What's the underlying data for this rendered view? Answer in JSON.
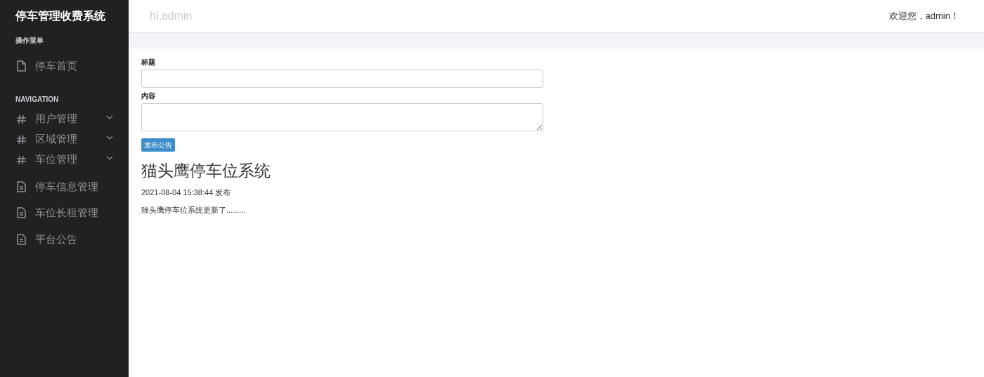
{
  "sidebar": {
    "title": "停车管理收费系统",
    "sections": [
      {
        "heading": "操作菜单",
        "items": [
          {
            "label": "停车首页",
            "kind": "page"
          }
        ]
      },
      {
        "heading": "NAVIGATION",
        "items": [
          {
            "label": "用户管理",
            "kind": "group",
            "expanded": false
          },
          {
            "label": "区域管理",
            "kind": "group",
            "expanded": false
          },
          {
            "label": "车位管理",
            "kind": "group",
            "expanded": false
          },
          {
            "label": "停车信息管理",
            "kind": "doc"
          },
          {
            "label": "车位长租管理",
            "kind": "doc"
          },
          {
            "label": "平台公告",
            "kind": "doc"
          }
        ]
      }
    ]
  },
  "topbar": {
    "greeting": "hi,admin",
    "welcome": "欢迎您，admin！"
  },
  "form": {
    "fields": [
      {
        "label": "标题",
        "kind": "input"
      },
      {
        "label": "内容",
        "kind": "textarea"
      }
    ],
    "submit": "发布公告"
  },
  "notices": [
    {
      "title": "猫头鹰停车位系统",
      "time": "2021-08-04 15:38:44 发布",
      "body": "猫头鹰停车位系统更新了........."
    }
  ]
}
